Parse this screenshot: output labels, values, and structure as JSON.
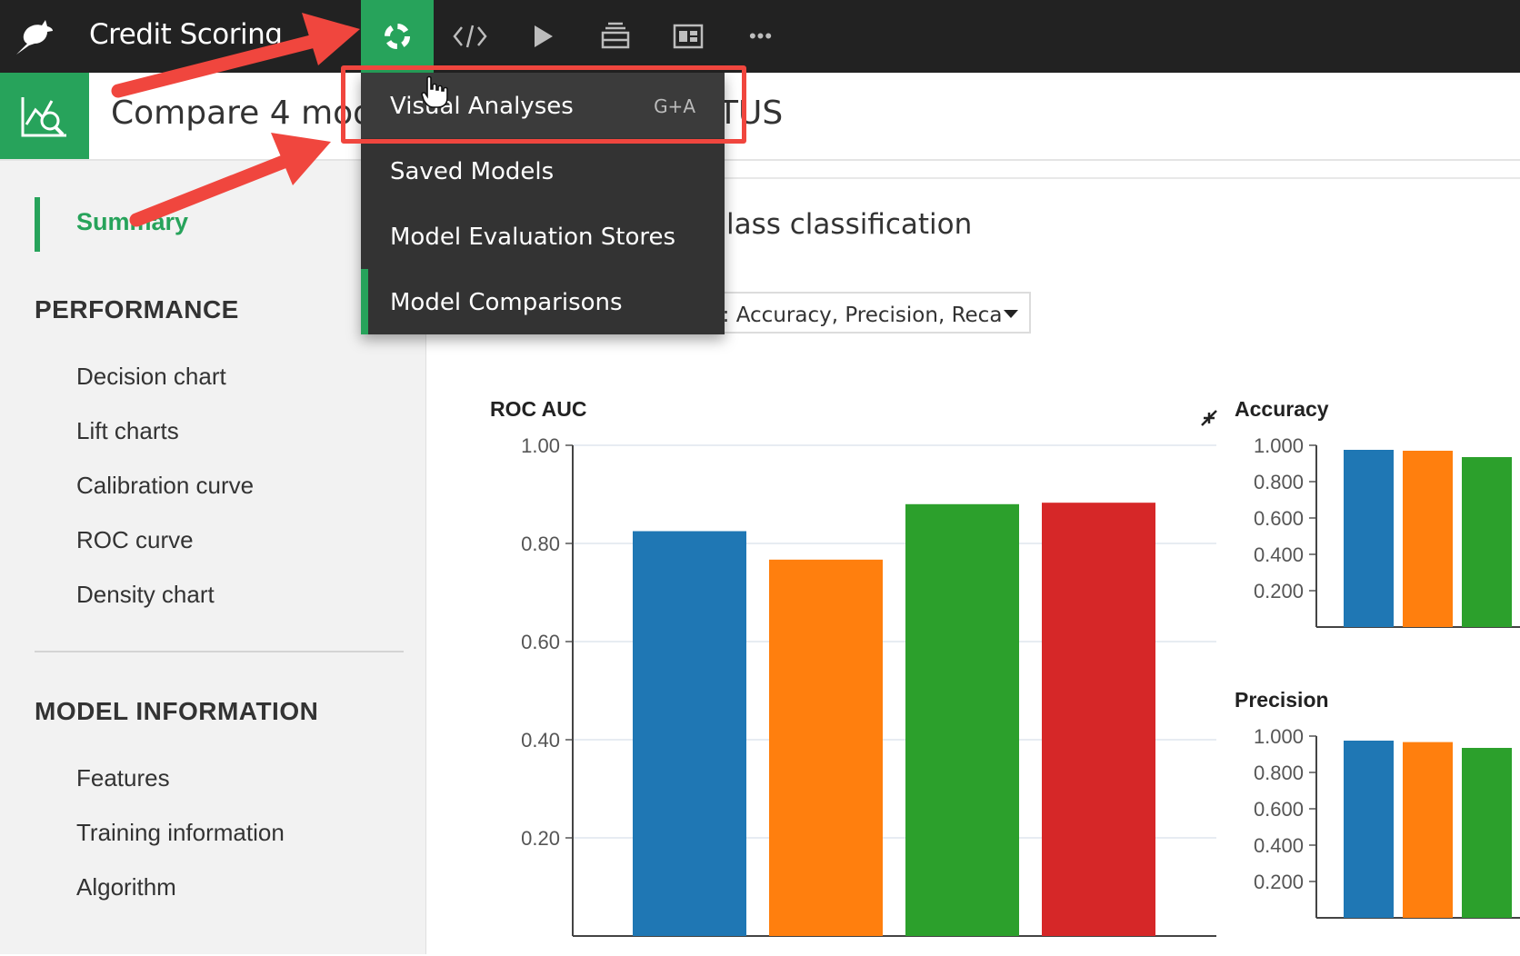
{
  "app": {
    "project_title": "Credit Scoring"
  },
  "topnav": {
    "buttons": [
      {
        "name": "visual-analyses-nav-button",
        "icon": "lifebuoy-icon",
        "active": true
      },
      {
        "name": "code-nav-button",
        "icon": "code-icon"
      },
      {
        "name": "run-nav-button",
        "icon": "play-icon"
      },
      {
        "name": "datasets-nav-button",
        "icon": "stack-icon"
      },
      {
        "name": "dashboard-nav-button",
        "icon": "dashboard-icon"
      },
      {
        "name": "more-nav-button",
        "icon": "more-icon",
        "label": "•••"
      }
    ]
  },
  "subheader": {
    "title_left": "Compare 4 mode",
    "title_right": "TUS"
  },
  "dropdown_menu": {
    "items": [
      {
        "label": "Visual Analyses",
        "shortcut": "G+A"
      },
      {
        "label": "Saved Models"
      },
      {
        "label": "Model Evaluation Stores"
      },
      {
        "label": "Model Comparisons"
      }
    ]
  },
  "sidebar": {
    "summary": "Summary",
    "performance_heading": "PERFORMANCE",
    "performance_items": [
      "Decision chart",
      "Lift charts",
      "Calibration curve",
      "ROC curve",
      "Density chart"
    ],
    "model_info_heading": "MODEL INFORMATION",
    "model_info_items": [
      "Features",
      "Training information",
      "Algorithm"
    ]
  },
  "main": {
    "heading": "lass classification",
    "metric_select_value": "c: Accuracy, Precision, Reca"
  },
  "colors": {
    "accent": "#27a35b",
    "topbar": "#222222",
    "menu_bg": "#333333",
    "annotation": "#f0463e",
    "series": [
      "#1f77b4",
      "#ff7f0e",
      "#2ca02c",
      "#d62728"
    ]
  },
  "chart_data": [
    {
      "type": "bar",
      "title": "ROC AUC",
      "ylim": [
        0,
        1.0
      ],
      "yticks": [
        "1.00",
        "0.80",
        "0.60",
        "0.40",
        "0.20"
      ],
      "values": [
        0.825,
        0.767,
        0.88,
        0.883
      ],
      "grid": true
    },
    {
      "type": "bar",
      "title": "Accuracy",
      "ylim": [
        0,
        1.0
      ],
      "yticks": [
        "1.000",
        "0.800",
        "0.600",
        "0.400",
        "0.200"
      ],
      "values": [
        0.975,
        0.97,
        0.935
      ],
      "grid": false
    },
    {
      "type": "bar",
      "title": "Precision",
      "ylim": [
        0,
        1.0
      ],
      "yticks": [
        "1.000",
        "0.800",
        "0.600",
        "0.400",
        "0.200"
      ],
      "values": [
        0.975,
        0.967,
        0.935
      ],
      "grid": false
    }
  ]
}
